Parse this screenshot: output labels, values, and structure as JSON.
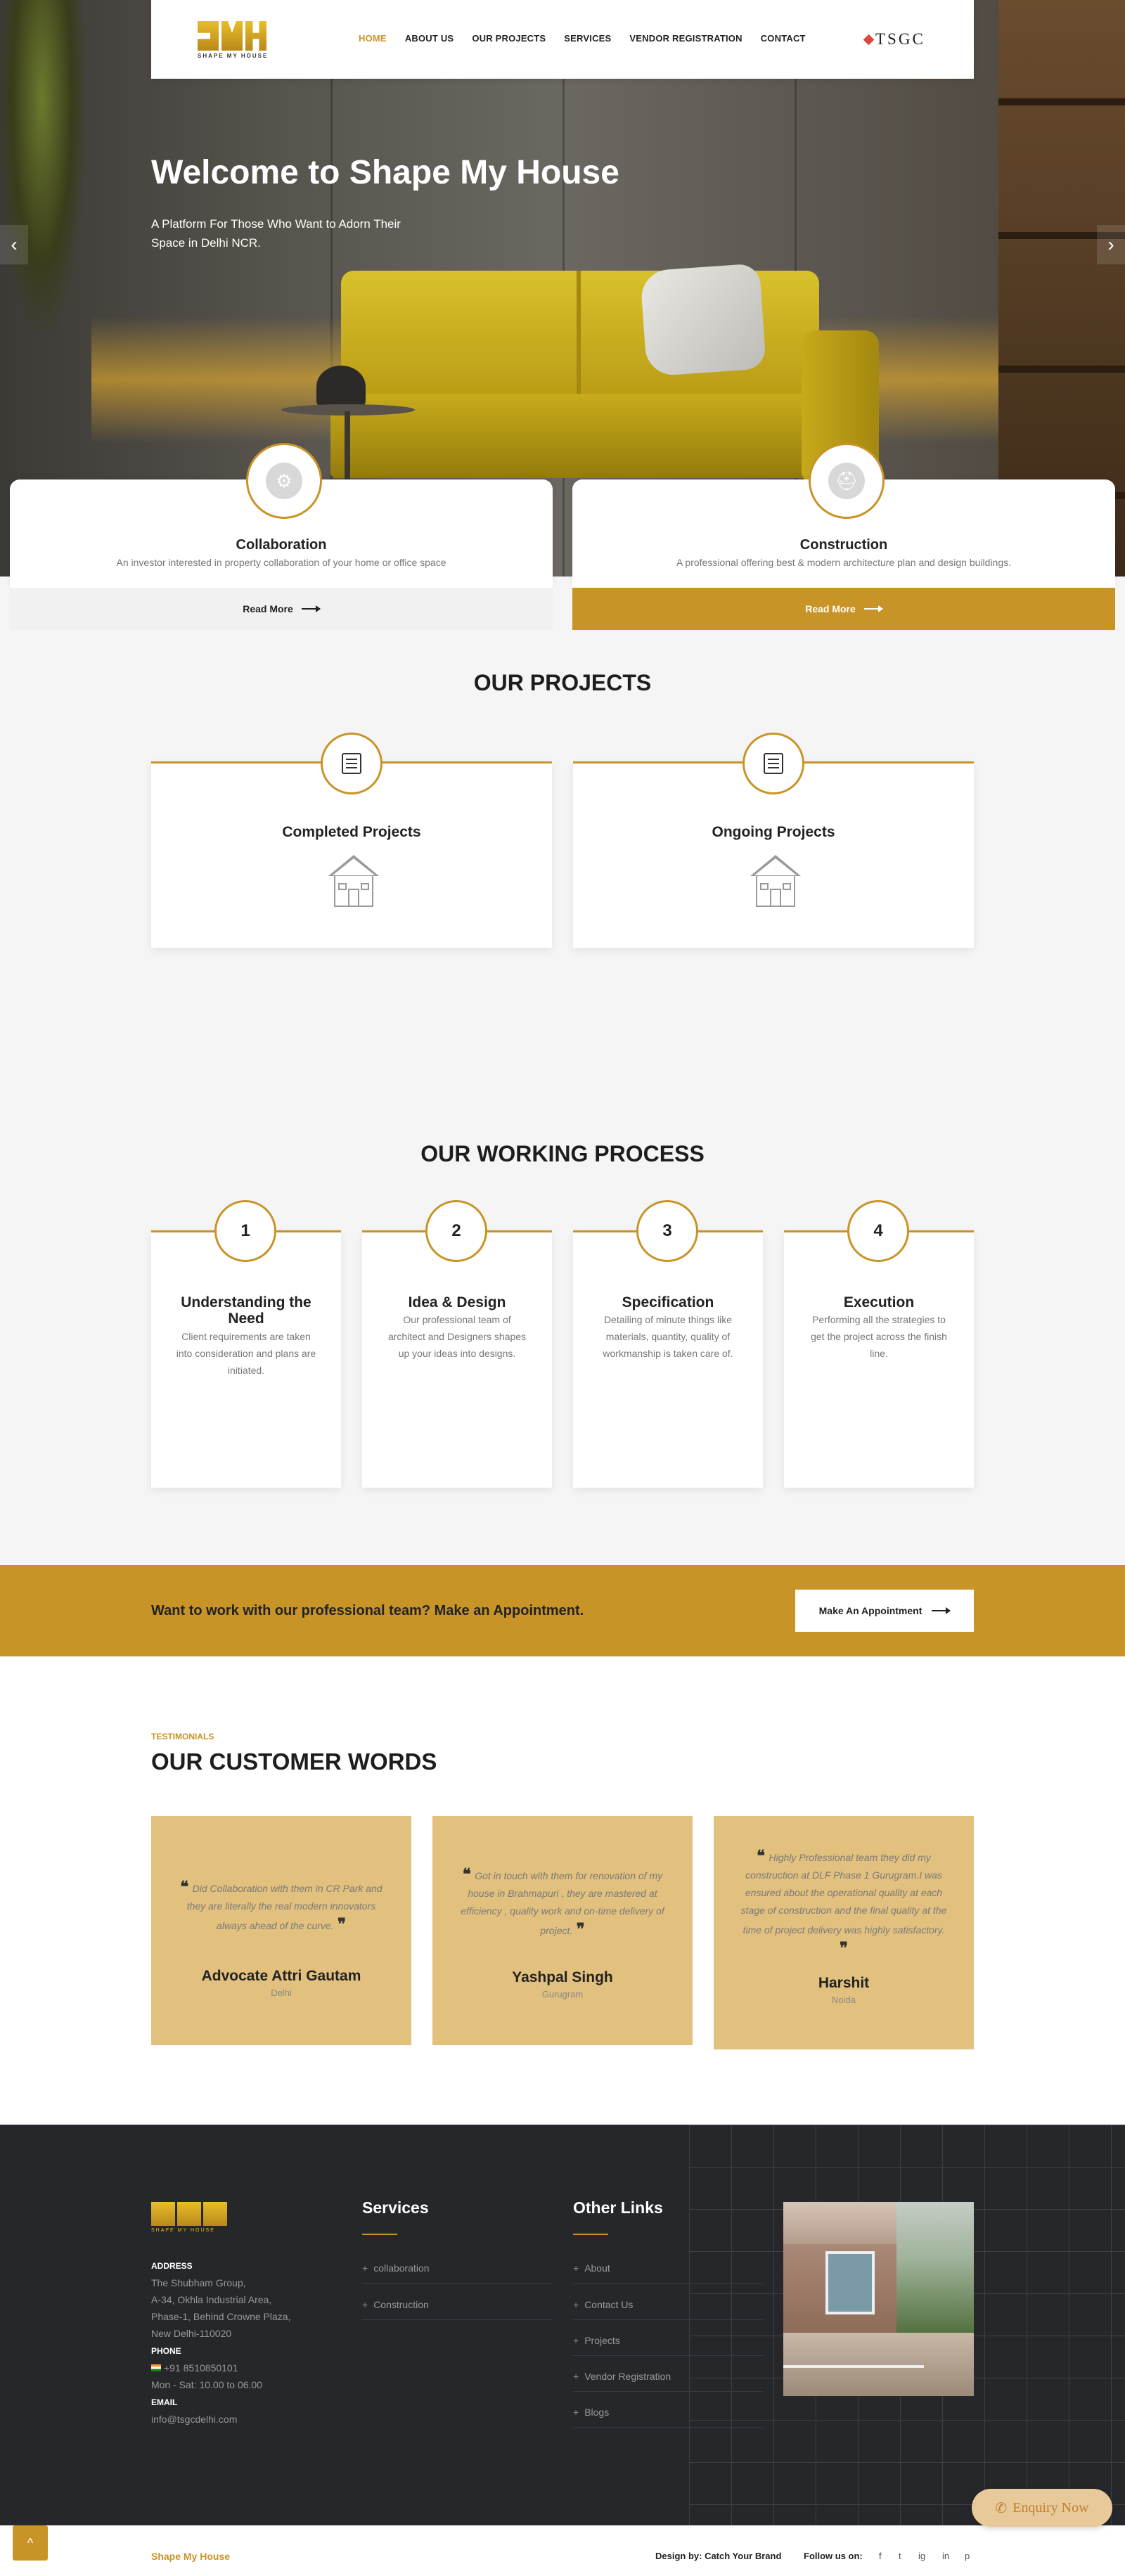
{
  "header": {
    "logo_tag": "SHAPE MY HOUSE",
    "nav": [
      "HOME",
      "ABOUT US",
      "OUR PROJECTS",
      "SERVICES",
      "VENDOR REGISTRATION",
      "CONTACT"
    ],
    "partner_logo": "TSGC"
  },
  "hero": {
    "title": "Welcome to Shape My House",
    "subtitle": "A Platform For Those Who Want to Adorn Their Space in Delhi NCR.",
    "prev_icon": "‹",
    "next_icon": "›"
  },
  "services": [
    {
      "title": "Collaboration",
      "desc": "An investor interested in property collaboration of your home or office space",
      "button": "Read More",
      "icon": "gear-icon"
    },
    {
      "title": "Construction",
      "desc": "A professional offering best & modern architecture plan and design buildings.",
      "button": "Read More",
      "icon": "helmet-icon"
    }
  ],
  "projects": {
    "title": "OUR PROJECTS",
    "items": [
      {
        "title": "Completed Projects",
        "icon": "document-icon"
      },
      {
        "title": "Ongoing Projects",
        "icon": "document-icon"
      }
    ]
  },
  "process": {
    "title": "OUR WORKING PROCESS",
    "steps": [
      {
        "num": "1",
        "title": "Understanding the Need",
        "desc": "Client requirements are taken into consideration and plans are initiated."
      },
      {
        "num": "2",
        "title": "Idea & Design",
        "desc": "Our professional team of architect and Designers shapes up your ideas into designs."
      },
      {
        "num": "3",
        "title": "Specification",
        "desc": "Detailing of minute things like materials, quantity, quality of workmanship is taken care of."
      },
      {
        "num": "4",
        "title": "Execution",
        "desc": "Performing all the strategies to get the project across the finish line."
      }
    ]
  },
  "appointment": {
    "text": "Want to work with our professional team? Make an Appointment.",
    "button": "Make An Appointment"
  },
  "testimonials": {
    "eyebrow": "TESTIMONIALS",
    "title": "OUR CUSTOMER WORDS",
    "items": [
      {
        "quote": "Did Collaboration with them in CR Park and they are literally the real modern innovators always ahead of the curve.",
        "name": "Advocate Attri Gautam",
        "location": "Delhi"
      },
      {
        "quote": "Got in touch with them for renovation of my house in Brahmapuri , they are mastered at efficiency , quality work and on-time delivery of project.",
        "name": "Yashpal Singh",
        "location": "Gurugram"
      },
      {
        "quote": "Highly Professional team they did my construction at DLF Phase 1 Gurugram.I was ensured about the operational quality at each stage of construction and the final quality at the time of project delivery was highly satisfactory.",
        "name": "Harshit",
        "location": "Noida"
      }
    ]
  },
  "footer": {
    "logo_tag": "SHAPE MY HOUSE",
    "address_label": "ADDRESS",
    "address_lines": [
      "The Shubham Group,",
      "A-34, Okhla Industrial Area,",
      "Phase-1, Behind Crowne Plaza,",
      "New Delhi-110020"
    ],
    "phone_label": "PHONE",
    "phone": "+91 8510850101",
    "hours": "Mon - Sat: 10.00 to 06.00",
    "email_label": "EMAIL",
    "email": "info@tsgcdelhi.com",
    "services_title": "Services",
    "services_links": [
      "collaboration",
      "Construction"
    ],
    "other_title": "Other Links",
    "other_links": [
      "About",
      "Contact Us",
      "Projects",
      "Vendor Registration",
      "Blogs"
    ]
  },
  "bottom": {
    "brand": "Shape My House",
    "design_credit": "Design by: Catch Your Brand",
    "follow": "Follow us on:",
    "social": [
      "f",
      "t",
      "ig",
      "in",
      "p"
    ]
  },
  "enquiry": "Enquiry Now",
  "scroll_top_icon": "^",
  "colors": {
    "accent": "#c89427",
    "footer_bg": "#26272b",
    "testimonial_bg": "#e2c07e"
  }
}
